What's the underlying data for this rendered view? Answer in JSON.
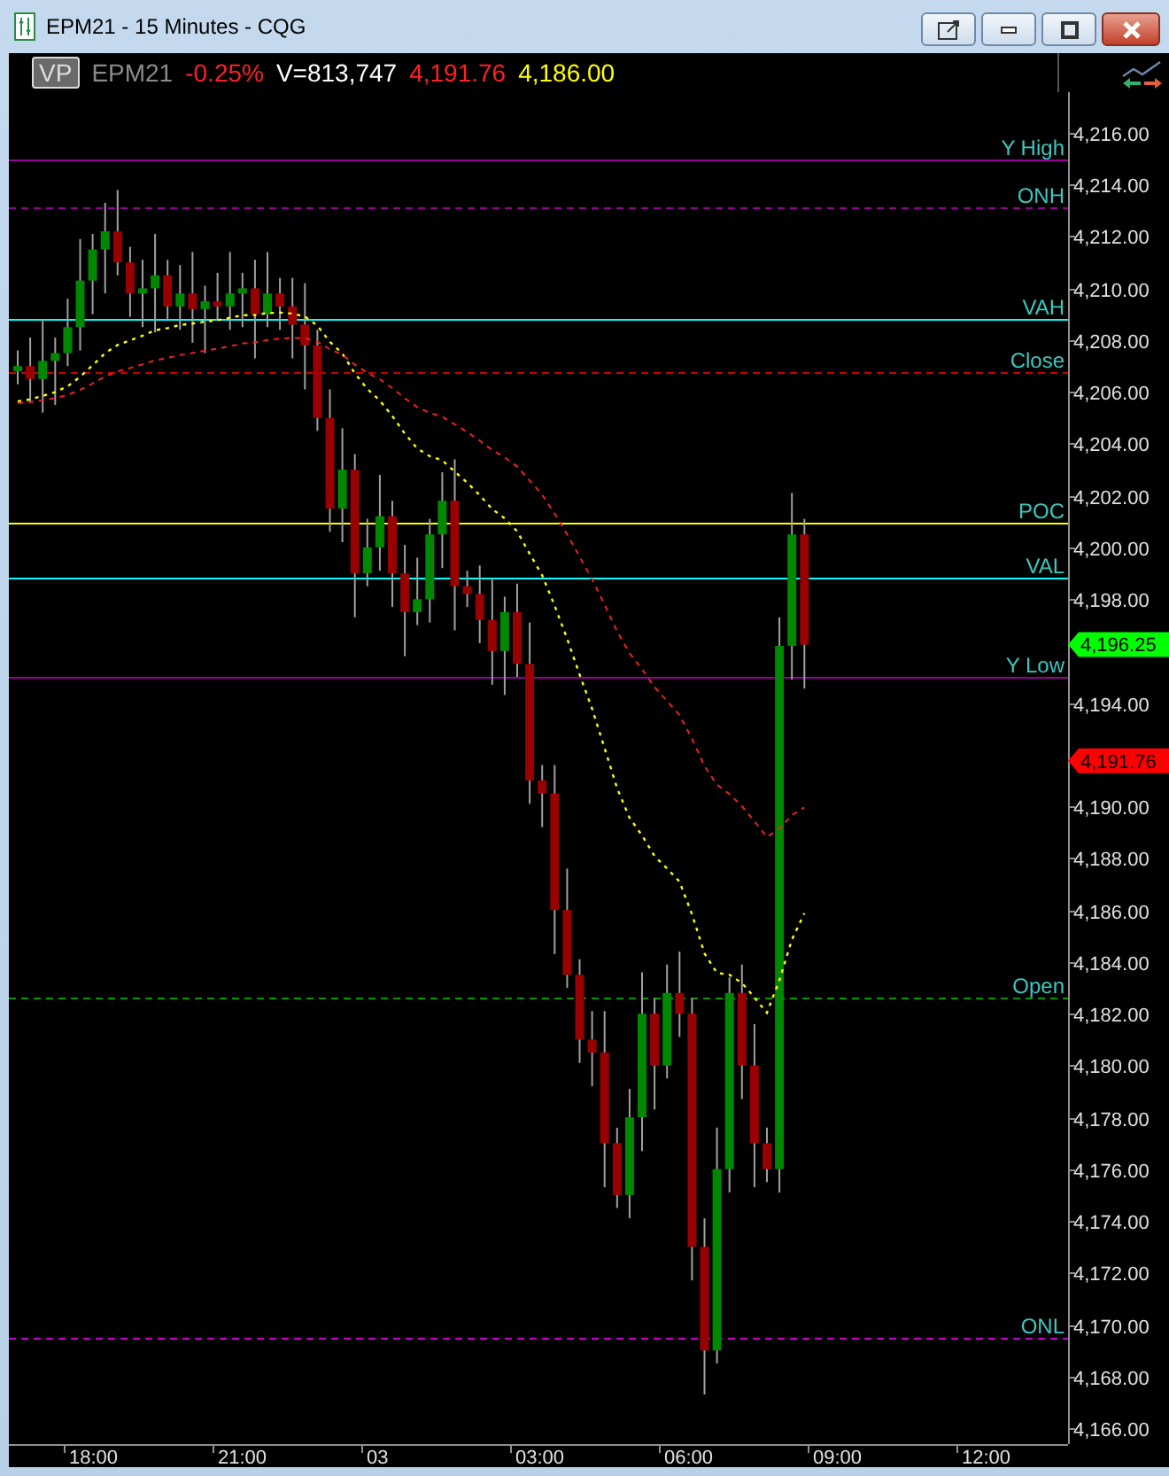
{
  "window": {
    "title": "EPM21 - 15 Minutes - CQG"
  },
  "header": {
    "badge": "VP",
    "symbol": "EPM21",
    "change": "-0.25%",
    "volume": "V=813,747",
    "last": "4,191.76",
    "reference": "4,186.00"
  },
  "chart": {
    "levels": [
      {
        "label": "Y High",
        "color": "#990099",
        "kind": "solid"
      },
      {
        "label": "ONH",
        "color": "#990099",
        "kind": "dashed"
      },
      {
        "label": "VAH",
        "color": "#00ffff",
        "kind": "solid"
      },
      {
        "label": "Close",
        "color": "#cc0000",
        "kind": "dashed"
      },
      {
        "label": "POC",
        "color": "#ffff00",
        "kind": "solid"
      },
      {
        "label": "VAL",
        "color": "#00ffff",
        "kind": "solid"
      },
      {
        "label": "Y Low",
        "color": "#990099",
        "kind": "solid"
      },
      {
        "label": "Open",
        "color": "#009900",
        "kind": "dashed"
      },
      {
        "label": "ONL",
        "color": "#cc00cc",
        "kind": "dashed"
      }
    ],
    "price_tags": [
      {
        "value": "4,196.25",
        "color": "#00ff00"
      },
      {
        "value": "4,191.76",
        "color": "#ff0000"
      }
    ],
    "y_axis": [
      "4,216.00",
      "4,214.00",
      "4,212.00",
      "4,210.00",
      "4,208.00",
      "4,206.00",
      "4,204.00",
      "4,202.00",
      "4,200.00",
      "4,198.00",
      "4,194.00",
      "4,190.00",
      "4,188.00",
      "4,186.00",
      "4,184.00",
      "4,182.00",
      "4,180.00",
      "4,178.00",
      "4,176.00",
      "4,174.00",
      "4,172.00",
      "4,170.00",
      "4,168.00",
      "4,166.00"
    ],
    "x_axis": [
      "18:00",
      "21:00",
      "03",
      "03:00",
      "06:00",
      "09:00",
      "12:00"
    ]
  }
}
